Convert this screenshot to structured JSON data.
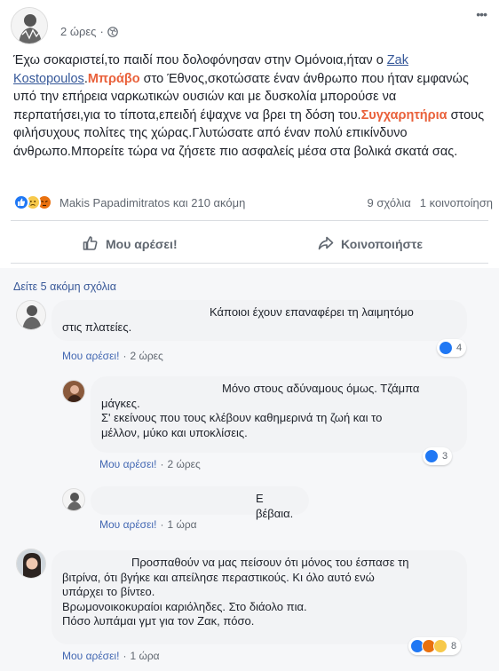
{
  "post": {
    "time": "2 ώρες",
    "privacy_icon": "globe-icon",
    "menu_icon": "more-dots-icon",
    "text_parts": [
      "Έχω σοκαριστεί,το παιδί που δολοφόνησαν στην Ομόνοια,ήταν ο ",
      "Zak Kostopoulos",
      ".",
      "Μπράβο",
      " στο Έθνος,σκοτώσατε έναν άνθρωπο που ήταν εμφανώς υπό την επήρεια ναρκωτικών ουσιών και με δυσκολία μπορούσε να περπατήσει,για το τίποτα,επειδή έψαχνε να βρει τη δόση του.",
      "Συγχαρητήρια",
      " στους φιλήσυχους πολίτες της χώρας.Γλυτώσατε από έναν πολύ επικίνδυνο άνθρωπο.Μπορείτε τώρα να ζήσετε πιο ασφαλείς μέσα στα βολικά σκατά σας."
    ],
    "reactors": "Makis Papadimitratos και 210 ακόμη",
    "comments_count": "9 σχόλια",
    "shares_count": "1 κοινοποίηση",
    "like_label": "Μου αρέσει!",
    "share_label": "Κοινοποιήστε"
  },
  "comments": {
    "more_label": "Δείτε 5 ακόμη σχόλια",
    "items": [
      {
        "line1": "Κάποιοι έχουν επαναφέρει τη λαιμητόμο",
        "line2": "στις πλατείες.",
        "like": "Μου αρέσει!",
        "time": "2 ώρες",
        "reactions_count": "4"
      },
      {
        "line1": "Μόνο στους αδύναμους όμως. Τζάμπα",
        "line2": "μάγκες.",
        "line3": "Σ' εκείνους που τους κλέβουν καθημερινά τη ζωή και το",
        "line4": "μέλλον, μύκο και υποκλίσεις.",
        "like": "Μου αρέσει!",
        "time": "2 ώρες",
        "reactions_count": "3"
      },
      {
        "line1": "Ε βέβαια.",
        "like": "Μου αρέσει!",
        "time": "1 ώρα"
      },
      {
        "line1": "Προσπαθούν να μας πείσουν ότι μόνος του έσπασε τη",
        "line2": "βιτρίνα, ότι βγήκε και απείλησε περαστικούς. Κι όλο αυτό ενώ",
        "line3": "υπάρχει το βίντεο.",
        "line4": "Βρωμονοικοκυραίοι καριόληδες. Στο διάολο πια.",
        "line5": "Πόσο λυπάμαι γμτ για τον Ζακ, πόσο.",
        "like": "Μου αρέσει!",
        "time": "1 ώρα",
        "reactions_count": "8"
      }
    ]
  },
  "colors": {
    "link": "#365899",
    "highlight": "#e9603a",
    "like_blue": "#2078f4"
  }
}
